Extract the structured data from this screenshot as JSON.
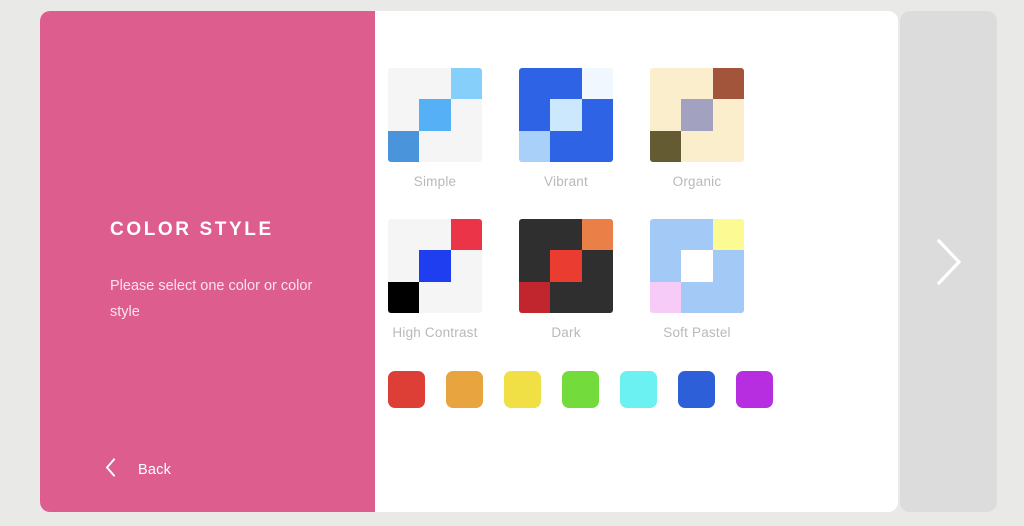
{
  "page": {
    "background_color": "#e9e9e7"
  },
  "card": {
    "background_color": "#ffffff"
  },
  "left_pane": {
    "background_color": "#de5d8f",
    "title": "COLOR STYLE",
    "subtitle": "Please select one color or color style",
    "back_button": {
      "label": "Back",
      "icon": "chevron-left-icon"
    }
  },
  "next_panel": {
    "background_color": "#dcdcdc",
    "arrow_icon": "chevron-right-icon",
    "arrow_color": "#ffffff"
  },
  "styles": {
    "rows": [
      [
        {
          "label": "Simple",
          "cells": [
            "#f5f5f5",
            "#f5f5f5",
            "#85cffa",
            "#f5f5f5",
            "#55b0f5",
            "#f5f5f5",
            "#4a94db",
            "#f5f5f5",
            "#f5f5f5"
          ]
        },
        {
          "label": "Vibrant",
          "cells": [
            "#2f63e6",
            "#2f63e6",
            "#f1f7fe",
            "#2f63e6",
            "#cbe8fc",
            "#2f63e6",
            "#a8d0f8",
            "#2f63e6",
            "#2f63e6"
          ]
        },
        {
          "label": "Organic",
          "cells": [
            "#fbeecc",
            "#fbeecc",
            "#a2553a",
            "#fbeecc",
            "#a2a1c0",
            "#fbeecc",
            "#655b33",
            "#fbeecc",
            "#fbeecc"
          ]
        }
      ],
      [
        {
          "label": "High Contrast",
          "cells": [
            "#f5f5f5",
            "#f5f5f5",
            "#ec3449",
            "#f5f5f5",
            "#1f3ef0",
            "#f5f5f5",
            "#000000",
            "#f5f5f5",
            "#f5f5f5"
          ]
        },
        {
          "label": "Dark",
          "cells": [
            "#302f2f",
            "#302f2f",
            "#ea8048",
            "#302f2f",
            "#ea3c30",
            "#302f2f",
            "#c1262f",
            "#302f2f",
            "#302f2f"
          ]
        },
        {
          "label": "Soft Pastel",
          "cells": [
            "#a3c9f6",
            "#a3c9f6",
            "#fcfa92",
            "#a3c9f6",
            "#ffffff",
            "#a3c9f6",
            "#f6cbf7",
            "#a3c9f6",
            "#a3c9f6"
          ]
        }
      ]
    ]
  },
  "color_swatches": [
    {
      "name": "red",
      "color": "#dd3f37"
    },
    {
      "name": "orange",
      "color": "#e8a43f"
    },
    {
      "name": "yellow",
      "color": "#f0e046"
    },
    {
      "name": "green",
      "color": "#73dc3c"
    },
    {
      "name": "cyan",
      "color": "#6bf1f1"
    },
    {
      "name": "blue",
      "color": "#2d5fd8"
    },
    {
      "name": "purple",
      "color": "#b72de0"
    }
  ]
}
